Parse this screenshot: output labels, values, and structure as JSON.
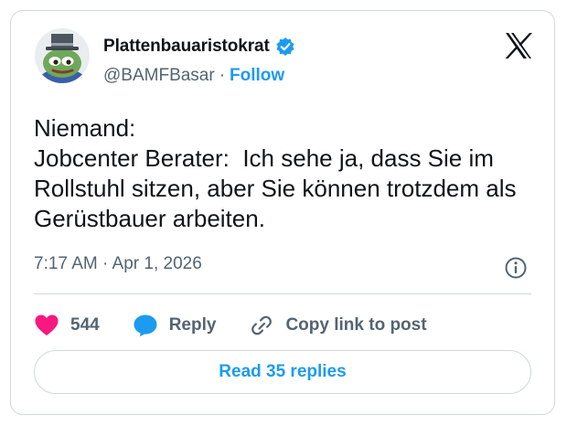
{
  "author": {
    "display_name": "Plattenbauaristokrat",
    "handle": "@BAMFBasar",
    "separator": "·",
    "follow_label": "Follow",
    "verified": true,
    "avatar_icon": "pepe-frog-top-hat-avatar"
  },
  "platform_icon": "x-logo-icon",
  "tweet": {
    "text": "Niemand:\nJobcenter Berater:  Ich sehe ja, dass Sie im Rollstuhl sitzen, aber Sie können trotzdem als Gerüstbauer arbeiten.",
    "timestamp": "7:17 AM · Apr 1, 2026"
  },
  "actions": {
    "like_count": "544",
    "reply_label": "Reply",
    "copy_link_label": "Copy link to post"
  },
  "read_replies_label": "Read 35 replies",
  "colors": {
    "accent": "#1d9bf0",
    "like": "#f91880",
    "text": "#0f1419",
    "muted": "#536471",
    "border": "#cfd9de"
  }
}
